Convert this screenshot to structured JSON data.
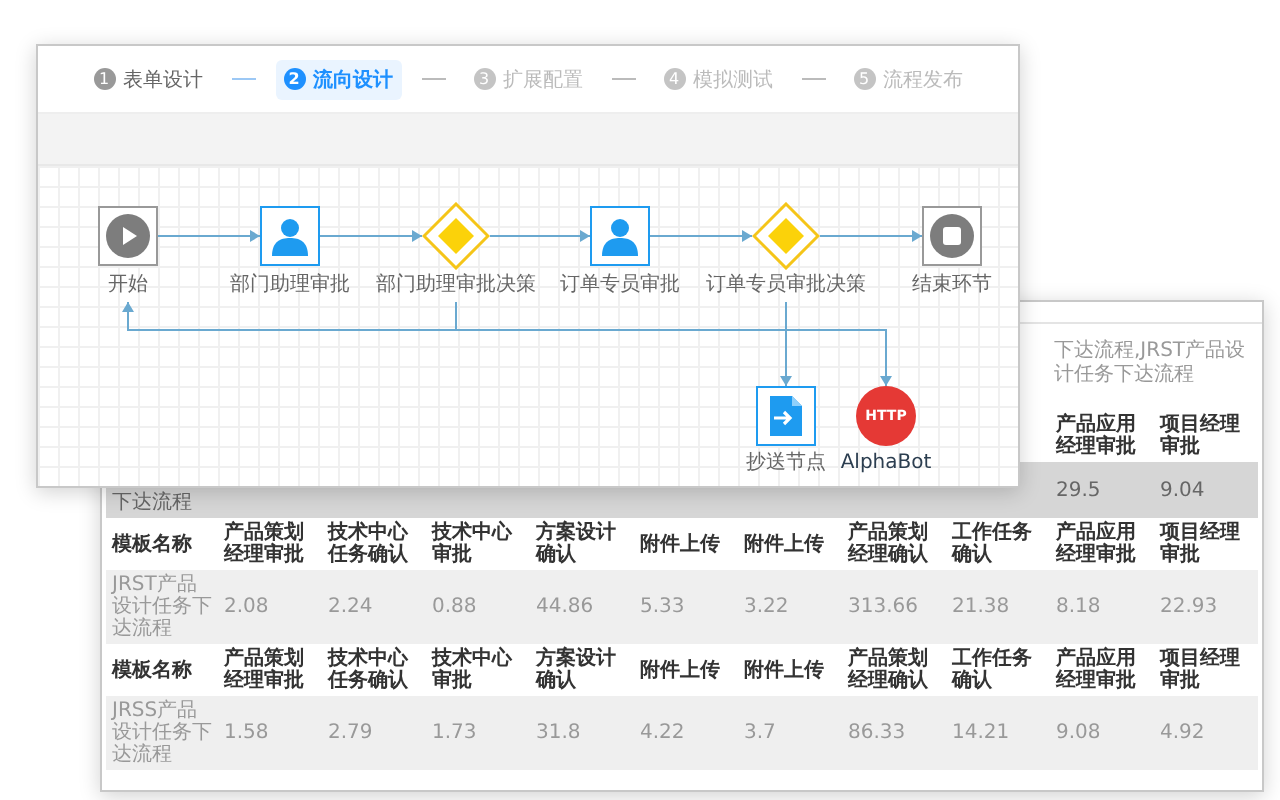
{
  "steps": [
    {
      "number": "1",
      "label": "表单设计",
      "selected": false,
      "completed": true
    },
    {
      "number": "2",
      "label": "流向设计",
      "selected": true,
      "completed": false
    },
    {
      "number": "3",
      "label": "扩展配置",
      "selected": false,
      "completed": false
    },
    {
      "number": "4",
      "label": "模拟测试",
      "selected": false,
      "completed": false
    },
    {
      "number": "5",
      "label": "流程发布",
      "selected": false,
      "completed": false
    }
  ],
  "flow": {
    "nodes": [
      {
        "kind": "start",
        "label": "开始"
      },
      {
        "kind": "approval",
        "label": "部门助理审批"
      },
      {
        "kind": "decision",
        "label": "部门助理审批决策"
      },
      {
        "kind": "approval",
        "label": "订单专员审批"
      },
      {
        "kind": "decision",
        "label": "订单专员审批决策"
      },
      {
        "kind": "end",
        "label": "结束环节"
      }
    ],
    "branch_nodes": [
      {
        "kind": "copy",
        "label": "抄送节点"
      },
      {
        "kind": "http",
        "label": "AlphaBot",
        "badge": "HTTP"
      }
    ]
  },
  "report": {
    "summary": "下达流程,JRST产品设计任务下达流程",
    "sections": [
      {
        "kind": "partial",
        "columns": [
          "产品应用经理审批",
          "项目经理审批"
        ],
        "row": {
          "name": "下达流程",
          "values": [
            "29.5",
            "9.04"
          ]
        }
      },
      {
        "kind": "full",
        "columns": [
          "模板名称",
          "产品策划经理审批",
          "技术中心任务确认",
          "技术中心审批",
          "方案设计确认",
          "附件上传",
          "附件上传",
          "产品策划经理确认",
          "工作任务确认",
          "产品应用经理审批",
          "项目经理审批"
        ],
        "row": {
          "name": "JRST产品设计任务下达流程",
          "values": [
            "2.08",
            "2.24",
            "0.88",
            "44.86",
            "5.33",
            "3.22",
            "313.66",
            "21.38",
            "8.18",
            "22.93"
          ]
        }
      },
      {
        "kind": "full",
        "columns": [
          "模板名称",
          "产品策划经理审批",
          "技术中心任务确认",
          "技术中心审批",
          "方案设计确认",
          "附件上传",
          "附件上传",
          "产品策划经理确认",
          "工作任务确认",
          "产品应用经理审批",
          "项目经理审批"
        ],
        "row": {
          "name": "JRSS产品设计任务下达流程",
          "values": [
            "1.58",
            "2.79",
            "1.73",
            "31.8",
            "4.22",
            "3.7",
            "86.33",
            "14.21",
            "9.08",
            "4.92"
          ]
        }
      }
    ]
  }
}
